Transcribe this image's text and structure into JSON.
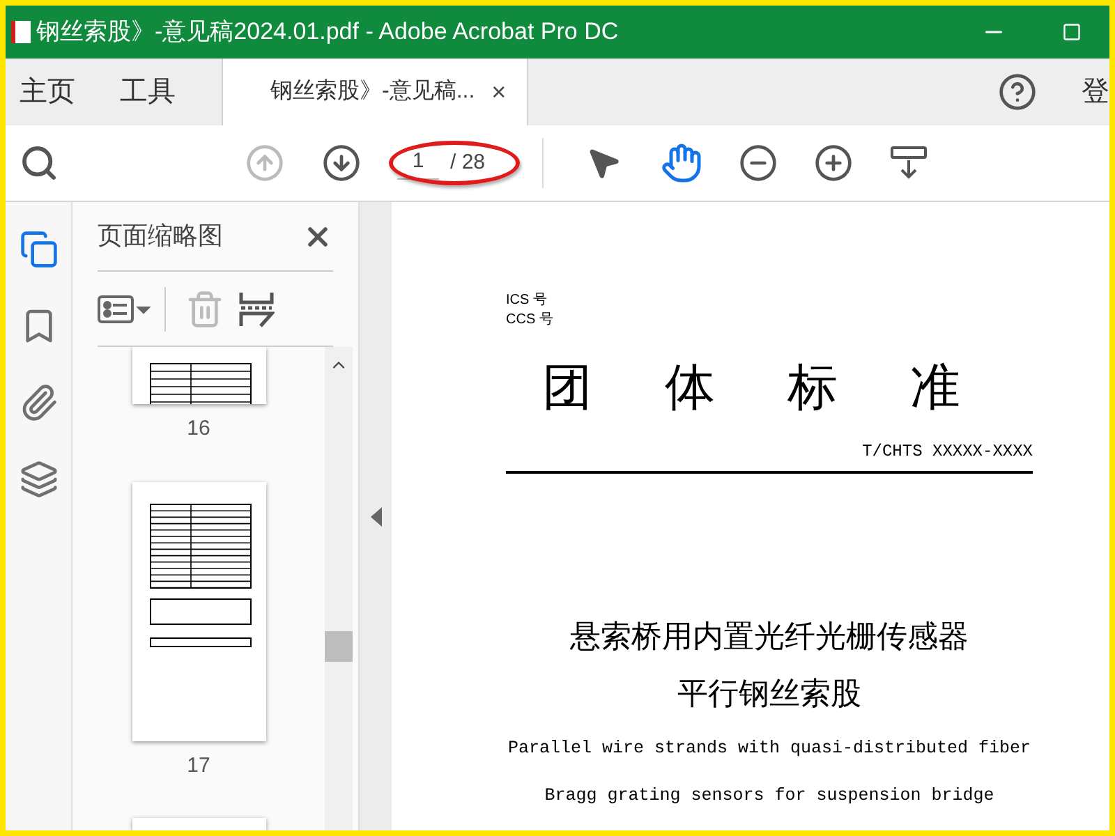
{
  "window": {
    "title": "钢丝索股》-意见稿2024.01.pdf - Adobe Acrobat Pro DC"
  },
  "top_tabs": [
    {
      "label": "主页",
      "selected": false
    },
    {
      "label": "工具",
      "selected": false
    }
  ],
  "document_tab": {
    "label": "钢丝索股》-意见稿...",
    "close": "×",
    "selected": true
  },
  "account_label": "登",
  "toolbar": {
    "page_current": "1",
    "page_total": "/ 28",
    "previous_disabled": true,
    "hand_tool_selected": true
  },
  "sidebar": {
    "items": [
      {
        "kind": "pages",
        "selected": true
      },
      {
        "kind": "bookmarks",
        "selected": false
      },
      {
        "kind": "attachments",
        "selected": false
      },
      {
        "kind": "layers",
        "selected": false
      }
    ]
  },
  "thumbnail_panel": {
    "title": "页面缩略图",
    "thumbnails": [
      {
        "label": "16"
      },
      {
        "label": "17"
      }
    ]
  },
  "document": {
    "codes": [
      "ICS 号",
      "CCS 号"
    ],
    "heading": "团体标准",
    "standard_number": "T/CHTS XXXXX-XXXX",
    "title_lines": [
      "悬索桥用内置光纤光栅传感器",
      "平行钢丝索股"
    ],
    "english_lines": [
      "Parallel wire strands with quasi-distributed fiber",
      "Bragg grating sensors for suspension bridge"
    ]
  }
}
